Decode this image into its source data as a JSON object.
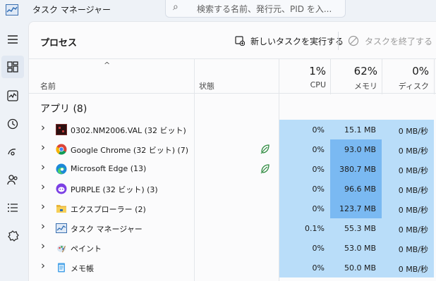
{
  "window": {
    "title": "タスク マネージャー",
    "search_placeholder": "検索する名前、発行元、PID を入..."
  },
  "nav": [
    "processes-icon",
    "performance-icon",
    "app-history-icon",
    "startup-icon",
    "users-icon",
    "details-icon",
    "services-icon"
  ],
  "toolbar": {
    "page_title": "プロセス",
    "new_task": "新しいタスクを実行する",
    "end_task": "タスクを終了する"
  },
  "header": {
    "sort_arrow": "^",
    "name": "名前",
    "status": "状態",
    "cpu_pct": "1%",
    "cpu_label": "CPU",
    "mem_pct": "62%",
    "mem_label": "メモリ",
    "disk_pct": "0%",
    "disk_label": "ディスク"
  },
  "group": {
    "label": "アプリ (8)"
  },
  "colors": {
    "cell_bg": "#b9ddf9",
    "cell_hot": "#7ab9f2",
    "accent": "#0067c0"
  },
  "processes": [
    {
      "name": "0302.NM2006.VAL (32 ビット)",
      "icon": "dark-app-icon",
      "eco": false,
      "cpu": "0%",
      "memory": "15.1 MB",
      "disk": "0 MB/秒",
      "mem_hot": false
    },
    {
      "name": "Google Chrome (32 ビット) (7)",
      "icon": "chrome-icon",
      "eco": true,
      "cpu": "0%",
      "memory": "93.0 MB",
      "disk": "0 MB/秒",
      "mem_hot": true
    },
    {
      "name": "Microsoft Edge (13)",
      "icon": "edge-icon",
      "eco": true,
      "cpu": "0%",
      "memory": "380.7 MB",
      "disk": "0 MB/秒",
      "mem_hot": true
    },
    {
      "name": "PURPLE (32 ビット) (3)",
      "icon": "purple-icon",
      "eco": false,
      "cpu": "0%",
      "memory": "96.6 MB",
      "disk": "0 MB/秒",
      "mem_hot": true
    },
    {
      "name": "エクスプローラー (2)",
      "icon": "folder-icon",
      "eco": false,
      "cpu": "0%",
      "memory": "123.7 MB",
      "disk": "0 MB/秒",
      "mem_hot": true
    },
    {
      "name": "タスク マネージャー",
      "icon": "task-manager-icon",
      "eco": false,
      "cpu": "0.1%",
      "memory": "55.3 MB",
      "disk": "0 MB/秒",
      "mem_hot": false
    },
    {
      "name": "ペイント",
      "icon": "paint-icon",
      "eco": false,
      "cpu": "0%",
      "memory": "53.0 MB",
      "disk": "0 MB/秒",
      "mem_hot": false
    },
    {
      "name": "メモ帳",
      "icon": "notepad-icon",
      "eco": false,
      "cpu": "0%",
      "memory": "50.0 MB",
      "disk": "0 MB/秒",
      "mem_hot": false
    }
  ]
}
